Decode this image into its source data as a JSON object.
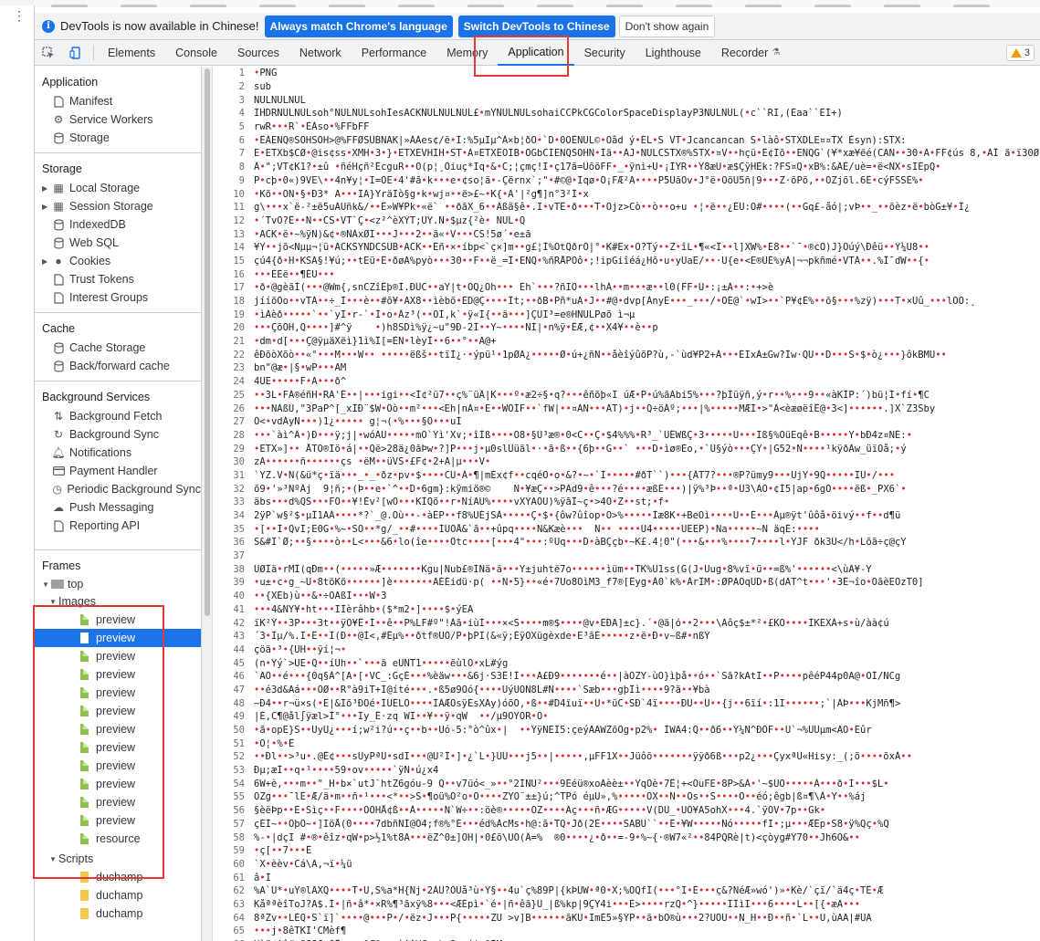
{
  "infobar": {
    "message": "DevTools is now available in Chinese!",
    "btn_match": "Always match Chrome's language",
    "btn_switch": "Switch DevTools to Chinese",
    "btn_dismiss": "Don't show again"
  },
  "tabs": [
    {
      "label": "Elements"
    },
    {
      "label": "Console"
    },
    {
      "label": "Sources"
    },
    {
      "label": "Network"
    },
    {
      "label": "Performance"
    },
    {
      "label": "Memory"
    },
    {
      "label": "Application"
    },
    {
      "label": "Security"
    },
    {
      "label": "Lighthouse"
    },
    {
      "label": "Recorder"
    }
  ],
  "warnings_count": "3",
  "sidebar": {
    "application": {
      "title": "Application",
      "items": [
        "Manifest",
        "Service Workers",
        "Storage"
      ]
    },
    "storage": {
      "title": "Storage",
      "items": [
        "Local Storage",
        "Session Storage",
        "IndexedDB",
        "Web SQL",
        "Cookies",
        "Trust Tokens",
        "Interest Groups"
      ]
    },
    "cache": {
      "title": "Cache",
      "items": [
        "Cache Storage",
        "Back/forward cache"
      ]
    },
    "background": {
      "title": "Background Services",
      "items": [
        "Background Fetch",
        "Background Sync",
        "Notifications",
        "Payment Handler",
        "Periodic Background Sync",
        "Push Messaging",
        "Reporting API"
      ]
    },
    "frames": {
      "title": "Frames",
      "top": "top",
      "images": "Images",
      "image_items": [
        "preview",
        "preview",
        "preview",
        "preview",
        "preview",
        "preview",
        "preview",
        "preview",
        "preview",
        "preview",
        "preview",
        "preview",
        "resource"
      ],
      "scripts": "Scripts",
      "script_items": [
        "duchamp",
        "duchamp",
        "duchamp"
      ]
    }
  },
  "code_lines": [
    "•PNG",
    "sub",
    "NULNULNUL",
    "IHDRNULNULsoh°NULNULsohÌesACKNULNULNUL£•mYNULNULsohaiCCPkCGColorSpaceDisplayP3NULNUL(•c``RI,(Èaa``ÈÍ+)",
    "rwR•••R`•ÈÀso•%FFbFF",
    "•ÊÀENQ®SOHSOH>@%FFØSUBNAK|»ÄÀes¢/ë•Ì:%5µIµ^À×b¦ðÕ•`D•0ÕÊNUL©•Ôâd ý•ÈL•S VT•Jcancancan S•làô•STXDLE¤¤TX Èsyn):STX:",
    "Ë•ETXb$CØ•@is¢ss•XMH•3•}•ETXÈVHIH•ST•Ã¤ETXÊOIB•OGbCÌENQSOHN•Ìã••ÄJ•NULCSTX®%STX•¤V••hçü•Ê¢Iõ••ENQG`(¥*xæ¥ëé(CAN••30•Ä•FF¢ús 8,•ÀÎ ä•ï30Øîÿ",
    "Â•\";VT¢K1?•±û •ñéHçñ²ÊcguR••Ö(p¦¸Õiuç*Iq•&•C;¦çmç!I•ç17ã=ÛõõFF•_•ÿnì+Ü•¡ÍYR••Y8æÜ•æ$ÇÿHÉk:?FS¤Q•xB%:&ÄÉ/uè=•ë<ÑX•sÏÉpQ•",
    "P•cþ•0«)9VE\\••4n¥y¦•I=ÕE•4'#ã•k•••e•¢so¦ä•-Çërnx`;\"•#©@•Iqø•O¡FÆ²Ä••••P5ÜãÖv•J°ë•OõÙ5ñ|9•••Z·õPõ,••ÕZjõl.6Ê•cýFSSÈ%•",
    "•Kõ••ÕÑ•§•Ð3* Ä•••ÏÄ}YräÏò§g•k•wj¤••ë>£~•K{•Ä'|²g¶]n°3²Í•x",
    "g\\•••x`ë-²±ë5uÀÜñk&/••Ê»W¥Pk•«ë` ••ðãX_6••Äßä§ê•.I•vTÊ•ð•••T•Ôjz>Cò••ò••o+u •¦•ë••¿ÉÙ:O#••••(••Gq£-åó|;vÞ••_••õèz•ë•bòG±¥•Î¿",
    "•´TvÕ?Ê••N••CS•VT`Ç•<z²^èXÝT;ÙY.N•$µz{²è• NUL•Q",
    "•ACK•ë•~%ÿÑ)&¢•®ÑÀxØÏ•••J•••2••ä«•V•••CS!5ø´•e±ã",
    "¥Y••jõ<Nµµ¬¦ü•ACKSYNDCSUB•ACK••Éñ•×•íbp<`ç×]m••g£¦Ì%ÕtQðrÕ|°•K#Ëx•Õ?Tý••Z•îL•¶«<Î••l]XW%•É8••`¯•®cÕ)J}Õúý\\Ðêü••Ý¼Ú8••",
    "çú4{ð•H•KSÃ§!¥ú;••tËü•Ê•ðøÄ%pyò•••30••F••ë_=Î•ENQ•%ñRÅPÕô•;!ipGiîéá¿Hõ•u•yUaE/••·Ú{e•<Ë®ÚÉ%yÀ|¬¬pkñmé•VTÁ••.%Î¯dW••{•",
    "•••ÉËë••¶ÉÚ•••",
    "•ð•@gèãÌ(•••@Wm{,snCZîÊþ®Ì.ÐÛC••aY|t•ÓQ¿Õh••• Éh`•••?ñIÕ•••lhÁ••m•••æ••l0(FF•Ú•:¡±À••:•+>è",
    "jííõÖo••vTÀ••÷_Ì•••è••#õ¥•ÃX8••ìèbõ•ÉD@Ç••••Ît;••ðB•Pñ*uA•J••#@•dvp[ÀnyÈ•••_•••/•ÕÉ@`•wI>••`P¥¢É%••õ§•••%zÿ)•••T•×Ûû_•••lÕÕ:¸",
    "•ìÀèð•••••`••`yÏ•r-`•Ì•o•Âz³(••ÕÌ,k`•ÿ«Í{••ä•••]ÇÚI³=e®HNULPøõ ì¬µ",
    "•••ÇõÕH,Q••••]#^ÿ    •)h8SDì%ÿ¿~u\"9Ð-2Í••Y~••••ÑÌ|•n%ÿ•ÊÆ,¢••X4¥••è••p",
    "•dm•d[•••Ç@ÿµäXëì}1ì%Î[=ÈÑ•lèyÎ••6••°••A@+",
    "êÐõòXõò••«°•••M•••W•• •••••ëßš••tïÌ¿·•ýpü¹•1pØÄ¿•••••Ø•ú+¿ñÑ••åèîýûõP?ù,-`ùd¥P2+Á•••ÉÏxÀ±Gw?Íw·QÜ••D•••S•$•ò¿•••}ôkBMU••",
    "bn\"@æ•|§•wP•••AM",
    "4ÛE•••••F•Ã•••ð^",
    "••3L•FÁ®éñH•RÀ'Ê••|•••igi••<Í¢²ü7••ç%¨üÂ|K•••º•æ2÷§•q?•••êñõþ«Ï úÆ•P•ú%ãÀbi5%•••?þÌüÿñ,ý•r••%•••9••«àKÍP:´)bü¦Í•fí•¶C",
    "•••ÑÀßÚ,\"3PaP^[_xÌÐ¨$W•Ôò••m²•••<Eh|nÄ¤•E••WÕÍF••`fW|••¤ÀN•••ÄT)•j••Q÷öÂº;•••|%•••••MÆÍ•>\"Â<èæøëîÊ@•3<]••••••.]X`Z3Sby",
    "Ö<•vdÁyN•••)1¿••••• g¦¬(•%•••§Ö•••uÌ",
    "•••`àì^Ä•)Ð•••ÿ;j|•wóÄÜ•••••mÖ`Ýì'X∨;•îÌß••••O8•§Ù³æ®•0<C••Ç•$4%%%•R³_`ÜÊWßÇ•3•••••Ü•••Iß§%ÖüEqê•B•••••Y•bÐ4z¤ÑÉ:•",
    "•ETX»]•• ÅTÕ®Ïö•á|••Që>28ä¿0ãÞw•?]P•••j•µ0slÙüãl•·•ã•ß••{6þ••G••` •••D•ìø®Èo,•`Ü§ýò•••ÇY•|G52•Ñ••••¹kÿðÄw_üïOå;•ý",
    "zÃ••••••ñ••••••çs •ëM••üVS•£F¢•2+Ä|µ•••V•",
    "`YZ.V•Ñ(&ü*ç•ïä•••_•_•ðz•pv•$••••CU•Ä•¶|mÉx¢f••cqéO•o•&?•~•`Ì•••••#ðT``)•••{ÂT7?•••®P?ümy9•••UjY•9Q•••••IÜ•/•••",
    "õ9•'»³ÑºÂj  9¦ñ;•(Þ••e•`^••D•6gm}:kÿmiö®©    N•¥æÇ••>PÄd9•ê•••?é••••æßÉ•••)|ÿ%³Þ••ª•Ú3\\ÃÖ•¢Í5|ap•6gÕ••••ëß•_PX6`•",
    "äbs•••d%QS•••FÕ••¥!Èv²[wO•••KÌQõ••r•NíÄÙ%••••vXÝÃÓU)%ÿãÎ~ç•>4Ö•Z••st;•f•",
    "2ÿP`w§²$•µÎ1AÀ••••*?`_@.Óù••-•àÉP••f8%ÚÉjSÀ•••••Ç•$•{ôw?ûîop•O>%•••••Ìæ8K•+BeÕì••••Ü••É•••Àµ®ÿt'ûôå•öivý••f••d¶ü",
    "•[••Ì•QvÏ;E0G•%~•SÖ••*g/_••#••••ÍÛÕÅ&`ã••+ûpq••••N&Kæè•••  Ñ•• ••••Ú4•••••ÜEEP)•Na•••••~N äqÉ:••••",
    "S&#Ï`Ø;••§••••ò••L<•••&6•lo(îe••••Ôtc••••[•••4\"•••:ºUq•••D•àBÇçb•~K£.4¦0\"(•••&•••%••••7••••l•YJF ðk3Ú</h•Lõã÷ç@çY",
    "",
    "ÜØÌä•rMÎ(qÐm••(•••••»Æ•••••••Kgu|Ñub£®ÍÑä•ä•••Ÿ±juhtë7o••••••ìüm••TK%Û1ss(G(J•Üug•8%vï•ü••=ß%'••••••<\\ùÄ¥-Y",
    "•u±•c•g_~Ú•8tõKõ••••••]è•••••••ÄÉÉidü·p( ••Ñ•5}••«é•7Uo8ÕìM3_f7®[Êyg•À0`k%•ÀrÏM•:ØPÃOqÛD•ß(dÃT^t•••'•3Ê¬îo•ÕãèEOzT0]",
    "••{XÈb)ù••&•÷OÃßÏ•••W•3",
    "•••4&ÑY¥•ht•••IÌèrâhb•($*m2•]••••$•ýEA",
    "ïK²Ý••3P•••3t••ÿÔ¥Ê•Ì••ê••P%LF#º\"!Àã•iùÌ•••×<S••••m®$••••@v•ÉÐÄ]±c}.´•@ã|ó••2•••\\Ãôç$±*²•£KÒ••••ÌKËXÀ+s•ù/àà¢ú",
    "´3•Ìµ/%.I•Ê••Ì(Ð••@Ì<,#Êµ%••ðtf®ÜÕ/P•þPI(&«ÿ;ÉÿÒXügèxde•E³ãÈ•••••z•ë•Ð•v~ß#•nßÝ",
    "çöä•³•{ÛH••ÿí¦¬•",
    "(n•Ýý`>ÜE•Q••íÛh••`•••ä eÜÑT1•••••ëùlÖ•xL#ýg",
    "`ÄÔ••é•••{0q§À^[A•[•VC_:GçÉ•••%èäw•••&6j·S3Ê!Ì•••Ä£Ð9•••••••é••|àÖZY-ùÕ}ìþå••ó••`Sã?kÃtI••P••••pêéP44p0Ã@•ÕÍ/NCg",
    "••é3d&Ãá•••ÕØ••R°à9iT+Ì@íté•••.•ß5ø9Õó{••••UýÜÕN8L#Ñ••••`Sæb•••gþÎì••••9?ä••¥bà",
    "~Ð4••r¬ü×s(•E|&Íõ³ÐÕé•ÍÜÉLÕ••••ÌÃÆÕsÿÉsXÃy)óõÕ,•ß••#D4ïuï••Ü•*üC•SÐ`4ï••••ÐÜ••Ú••{j••6ïí•:1I••••••;`|ÄÞ•••KjMñ¶>",
    "|É,C¶@ål∫ÿæl>Ì°•••Ïy_Ê·zq WÏ••¥••ÿ•qW  ••/µ9ÕYÕR•Ò•",
    "•ã•opE}S••ÜyÜ¿•••í;w²i?ú••ç••b••Uó-5:°ò^ûx•|  ••ÝÿÑEÏ5:çeýÃÄWZõÔg•p2%• ÌWÄ4:Q••ð6••Ý¼Ñ^ÐÓF••Ú`¬%ÚÚµm<ÃÕ•Èûr",
    "•Õ¦•%•Ê",
    "••Ðl••>³u•.@Ê¢•••sÜyPªÜ•sdI•••@Ù²Í•]•¿`L•}ÚÜ•••j5••|•••••,µFF1X••Jüôõ•••••••ÿÿð6ß•••p2¿•••ÇyxªÜ«Hisy:_(;õ••••õxÀ••",
    "Ðµ;æÌ••q•¹••••59•ov•••••`ÿÑ•ú¿x4",
    "6W+è,•••m••\"_H•b×`utJ`htZ6góu-9 Q••v7üó<_»••°2ÍÑÜ²•••9Èéü®xoÄèè±••YqÕè•7Ê¦+<ÔuFE•8P>&À•'~$ÜÖ•••••À•••ð•Ì•••$L•",
    "OZg•••¯lÊ•Æ/ã•m••ñ•¹•••<*••>S•¶oü%Ó²o•Õ••••ZYÕ¨±±}ú;^TPó éµÜ»,%•••••ÖX••Ñ••Õs••S••••O••éó;êgb|ß¤¶\\Â•Y••%áj",
    "§èëÞp••É•Sìç••F••••OÕHÅ¢ß••À•••••Ñ`W÷••:öè®•••••OZ••••Äç•••ñ•ÆG•••••V(DÚ_•UÕ¥Ä5ohX•••4.`ÿÕV•7p••Gk•",
    "çÉÌ~••ÖþÕ~•]IöÅ(0••••7dbñÑÍ@Õ4;f®%°È•••éd%ÀcMs•h@:ã•TQ•Jð(2É••••SÄBÜ``••Ë•¥W•••••Ñó•••••fI•;µ•••ÆÉp•S8•ÿ%Qç•%Q",
    "%-•|dçÏ #•®•êîz•qW•p>½1%t8Ä•••ëZ^0±]OH|•0£õ\\UÕ(Â=%  ®0••••¿•ð••=-9•%~{·®W7«²••84PQRè|t)<çòyg#Ý70••Jh6Õ&••",
    "•ç[••7•••Ê",
    "`X•èèv•Cá\\Ã,¬ï•¼ü",
    "â•Ì",
    "%A`Ú*•uY®lÄXQ••••T•U,S%a*H{Nj•2ÀÜ?ÕÛå³ù•Ý§••4u`ç%89P|{kÞÙW•ª0•X;%ÕQfÍ(•••°Ï•É•••ç&?NéÆ»wó')»•Kè/`çï/`ä4ç•TÊ•Æ",
    "KåªªèîToJ?Ã$.Ì•|ñ•â*•×R%¶³ãxÿ%8•••<ÆÉpì•`é•|ñ•êã}Ü_|ß%kp|9ÇY4i•••È>••••rzQ•^}•••••ÏÎìI•••6••••L••[{•æÃ•••",
    "8ªZv••LÉQ•S`ï]`••••@•••P•/•ëz•J•••P{•••••ZU >v]B••••••ãKÛ•ImÉ5»§ÝP••ã•bÕ®ù•••2?UÕÙ••Ñ_H••Ð••ñ•`L••Ú,ùAA|#ÙÄ",
    "•••j•8êTKÌ'CMèf¶",
    "Xàä•Äô#<ã8?CxÕÎe•<>ºÆ^•••`ÄÁYC••k•?;>íj•&ÍMsu"
  ]
}
